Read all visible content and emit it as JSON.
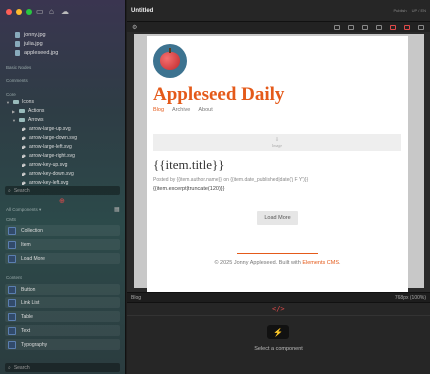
{
  "sidebar": {
    "window_controls": {
      "close": "#ff5f57",
      "minimize": "#febc2e",
      "maximize": "#28c840"
    },
    "files": [
      "jonny.jpg",
      "julia.jpg",
      "appleseed.jpg"
    ],
    "section_basic_nodes": "Basic Nodes",
    "section_comments": "Comments",
    "section_core": "Core",
    "tree": {
      "icons": "Icons",
      "actions": "Actions",
      "arrows": "Arrows",
      "svg_files": [
        "arrow-large-up.svg",
        "arrow-large-down.svg",
        "arrow-large-left.svg",
        "arrow-large-right.svg",
        "arrow-key-up.svg",
        "arrow-key-down.svg",
        "arrow-key-left.svg"
      ]
    },
    "search_placeholder_top": "Search",
    "components_header": "All Components",
    "cms_label": "CMS",
    "cms_items": [
      "Collection",
      "Item",
      "Load More"
    ],
    "content_label": "Content",
    "content_items": [
      "Button",
      "Link List",
      "Table",
      "Text",
      "Typography"
    ],
    "search_placeholder_bottom": "Search"
  },
  "toolbar": {
    "title": "Untitled",
    "publish_label": "Publish",
    "zoom_label": "UP / EN"
  },
  "page": {
    "site_title": "Appleseed Daily",
    "nav": [
      "Blog",
      "Archive",
      "About"
    ],
    "image_placeholder": "Image",
    "item_title": "{{item.title}}",
    "item_meta": "Posted by {{item.author.name}} on {{item.date_published|date('j F Y')}}",
    "item_excerpt": "{{item.excerpt|truncate(120)}}",
    "load_more": "Load More",
    "footer_text": "© 2025 Jonny Appleseed. Built with ",
    "footer_brand": "Elements CMS",
    "footer_end": ".",
    "accent_color": "#e45a1a"
  },
  "status": {
    "left": "Blog",
    "right": "768px (100%)"
  },
  "bottom_panel": {
    "message": "Select a component"
  }
}
